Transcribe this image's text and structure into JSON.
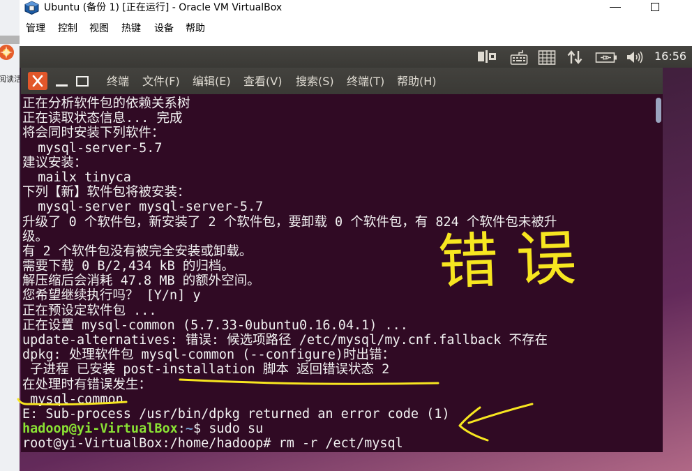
{
  "host_desktop": {
    "icon": "app-shortcut-icon",
    "icon_label": "阅读活"
  },
  "vbox": {
    "app_icon": "virtualbox-icon",
    "title": "Ubuntu (备份 1) [正在运行] - Oracle VM VirtualBox",
    "menu": [
      "管理",
      "控制",
      "视图",
      "热键",
      "设备",
      "帮助"
    ],
    "controls": [
      "minimize-icon",
      "maximize-icon"
    ]
  },
  "ubuntu_panel": {
    "indicators": [
      "input-method-icon",
      "keyboard-icon",
      "keyboard-layout-icon",
      "network-icon",
      "battery-icon",
      "volume-icon"
    ],
    "clock": "16:56"
  },
  "terminal": {
    "app_name": "终端",
    "controls": [
      "close-icon",
      "minimize-icon",
      "maximize-icon"
    ],
    "menu": [
      "文件(F)",
      "编辑(E)",
      "查看(V)",
      "搜索(S)",
      "终端(T)",
      "帮助(H)"
    ],
    "output_lines": [
      "正在分析软件包的依赖关系树",
      "正在读取状态信息... 完成",
      "将会同时安装下列软件：",
      "  mysql-server-5.7",
      "建议安装：",
      "  mailx tinyca",
      "下列【新】软件包将被安装：",
      "  mysql-server mysql-server-5.7",
      "升级了 0 个软件包，新安装了 2 个软件包，要卸载 0 个软件包，有 824 个软件包未被升",
      "级。",
      "有 2 个软件包没有被完全安装或卸载。",
      "需要下载 0 B/2,434 kB 的归档。",
      "解压缩后会消耗 47.8 MB 的额外空间。",
      "您希望继续执行吗？ [Y/n] y",
      "正在预设定软件包 ...",
      "正在设置 mysql-common (5.7.33-0ubuntu0.16.04.1) ...",
      "update-alternatives: 错误: 候选项路径 /etc/mysql/my.cnf.fallback 不存在",
      "dpkg: 处理软件包 mysql-common (--configure)时出错：",
      " 子进程 已安装 post-installation 脚本 返回错误状态 2",
      "在处理时有错误发生：",
      " mysql-common",
      "E: Sub-process /usr/bin/dpkg returned an error code (1)"
    ],
    "prompt": {
      "user_host": "hadoop@yi-VirtualBox",
      "separator": ":",
      "path": "~",
      "command": "$ sudo su"
    },
    "root_line": "root@yi-VirtualBox:/home/hadoop# rm -r /ect/mysql",
    "colors": {
      "background": "#300a24",
      "foreground": "#f2f2f2",
      "prompt_user": "#8ae234",
      "prompt_path": "#729fcf",
      "close_button": "#e2572b"
    }
  },
  "annotations": {
    "handwritten_text": "错误",
    "color": "#f7e620",
    "marks": [
      "underline-error-status",
      "underline-mysql-common",
      "arrow-to-error-code"
    ]
  }
}
